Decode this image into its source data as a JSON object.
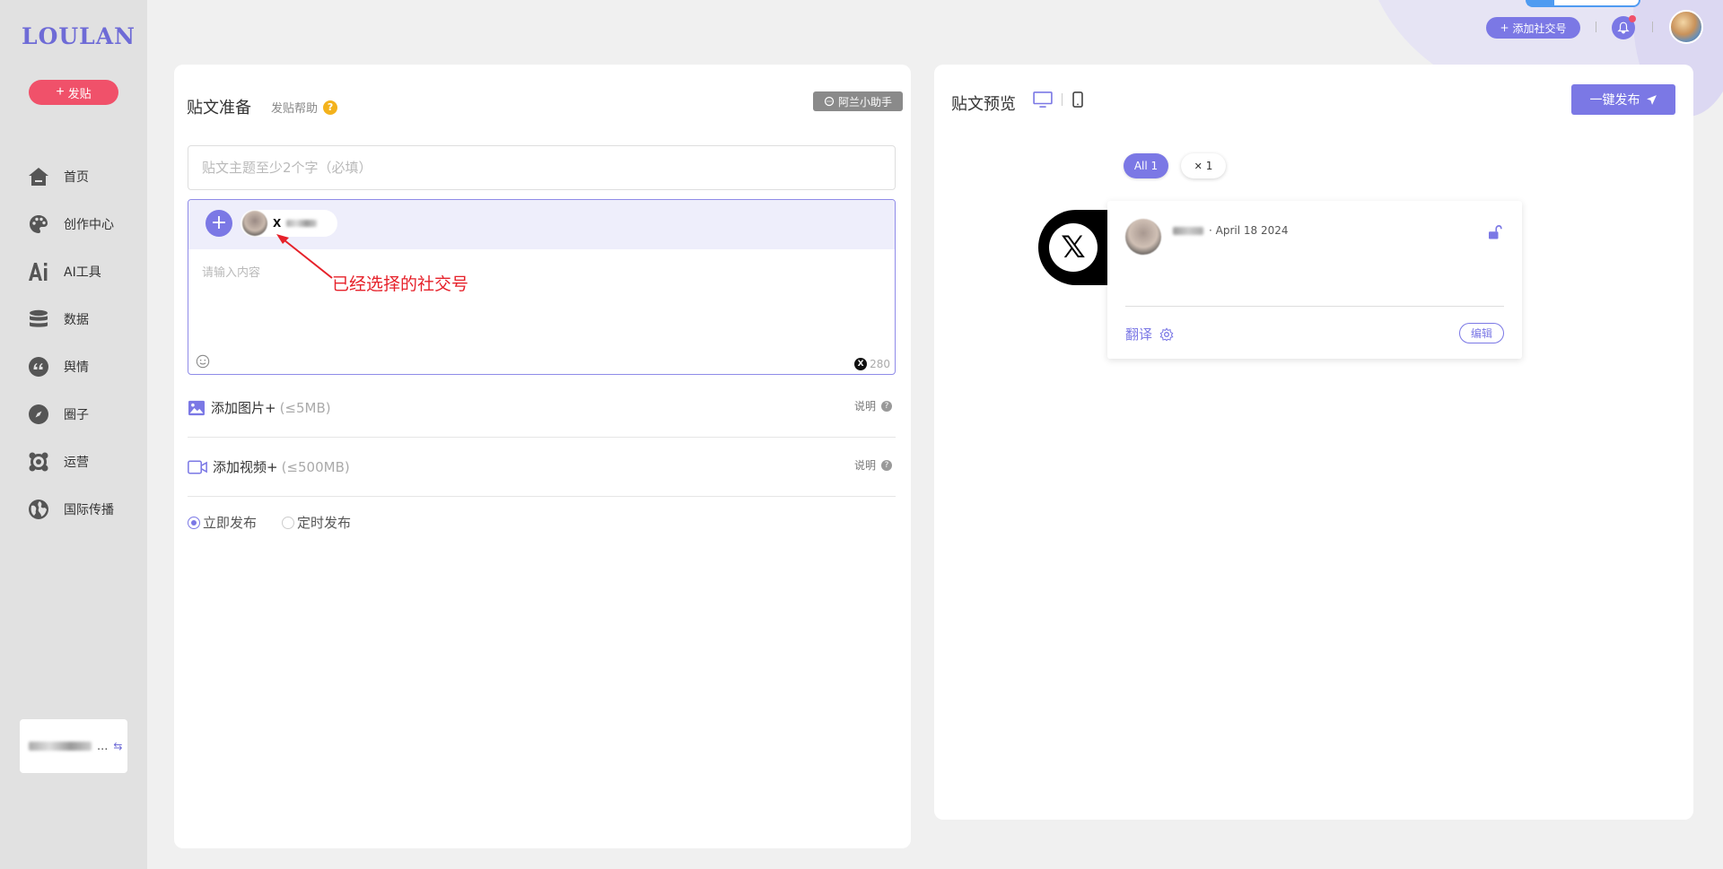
{
  "brand": {
    "logo_text": "LOULAN"
  },
  "sidebar": {
    "post_button_label": "发贴",
    "items": [
      {
        "label": "首页",
        "icon": "home-icon"
      },
      {
        "label": "创作中心",
        "icon": "palette-icon"
      },
      {
        "label": "AI工具",
        "icon": "ai-icon"
      },
      {
        "label": "数据",
        "icon": "database-icon"
      },
      {
        "label": "舆情",
        "icon": "quote-icon"
      },
      {
        "label": "圈子",
        "icon": "compass-icon"
      },
      {
        "label": "运营",
        "icon": "network-icon"
      },
      {
        "label": "国际传播",
        "icon": "globe-icon"
      }
    ],
    "account_suffix": "..."
  },
  "topbar": {
    "add_social_label": "添加社交号"
  },
  "compose": {
    "title": "贴文准备",
    "help_label": "发贴帮助",
    "assistant_label": "阿兰小助手",
    "subject_placeholder": "贴文主题至少2个字（必填）",
    "content_placeholder": "请输入内容",
    "char_limit": "280",
    "selected_account_platform": "X",
    "annotation": "已经选择的社交号",
    "add_image_label": "添加图片+",
    "add_image_limit": "(≤5MB)",
    "add_video_label": "添加视频+",
    "add_video_limit": "(≤500MB)",
    "note_label": "说明",
    "publish_now": "立即发布",
    "publish_scheduled": "定时发布"
  },
  "preview": {
    "title": "贴文预览",
    "one_click_label": "一键发布",
    "filter_all": "All 1",
    "filter_x_count": "1",
    "date": "· April 18 2024",
    "translate_label": "翻译",
    "edit_label": "编辑"
  },
  "colors": {
    "accent": "#7b78e5",
    "danger": "#f0516a",
    "annotation": "#e6212a",
    "sidebar_bg": "#e1e1e1"
  }
}
